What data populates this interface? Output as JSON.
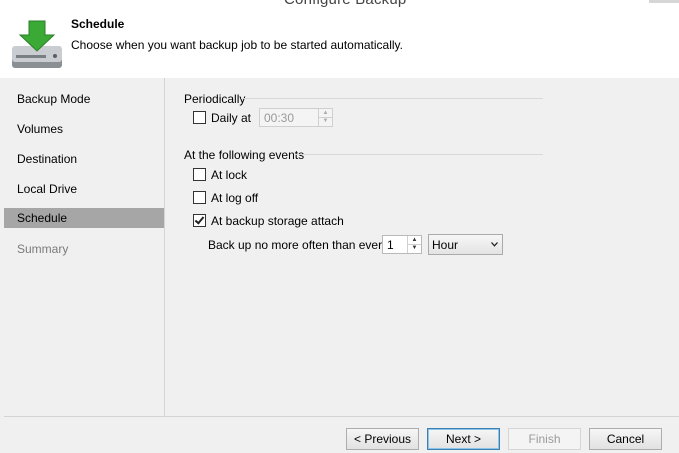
{
  "window": {
    "title": "Configure Backup"
  },
  "header": {
    "title": "Schedule",
    "description": "Choose when you want backup job to be started automatically.",
    "icon": "download-drive-icon"
  },
  "sidebar": {
    "items": [
      {
        "label": "Backup Mode",
        "state": "normal"
      },
      {
        "label": "Volumes",
        "state": "normal"
      },
      {
        "label": "Destination",
        "state": "normal"
      },
      {
        "label": "Local Drive",
        "state": "normal"
      },
      {
        "label": "Schedule",
        "state": "active"
      },
      {
        "label": "Summary",
        "state": "disabled"
      }
    ]
  },
  "periodically": {
    "group_label": "Periodically",
    "daily_label": "Daily at",
    "daily_checked": false,
    "time_value": "00:30"
  },
  "events": {
    "group_label": "At the following events",
    "at_lock": {
      "label": "At lock",
      "checked": false
    },
    "at_logoff": {
      "label": "At log off",
      "checked": false
    },
    "at_attach": {
      "label": "At backup storage attach",
      "checked": true
    },
    "frequency_label": "Back up no more often than every",
    "frequency_value": "1",
    "unit_value": "Hour"
  },
  "buttons": {
    "previous": "< Previous",
    "next": "Next >",
    "finish": "Finish",
    "cancel": "Cancel"
  },
  "colors": {
    "accent_green": "#3aa935",
    "selected_nav": "#a6a6a6",
    "panel_bg": "#f0f0f0",
    "primary_button_border": "#3c7fb1"
  }
}
